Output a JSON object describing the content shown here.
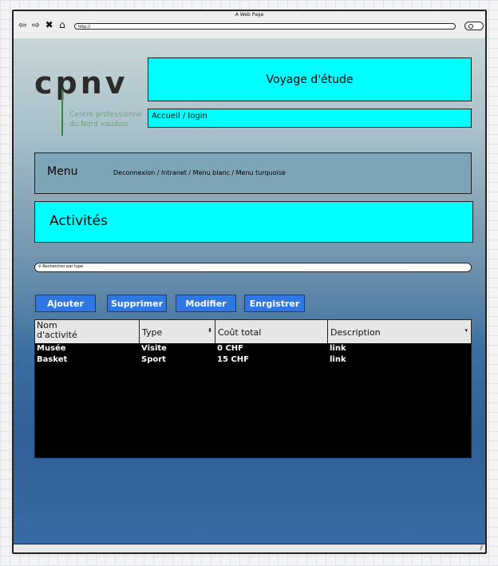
{
  "window": {
    "title": "A Web Page",
    "url": "http://"
  },
  "logo": {
    "word": "cpnv",
    "sub1": "Centre professionne",
    "sub2": "du Nord vaudois",
    "color": "#2f8a3a"
  },
  "header": {
    "title": "Voyage d'étude",
    "breadcrumb": "Accueil / login"
  },
  "menu": {
    "title": "Menu",
    "links": "Deconnexion / Intranet / Menu blanc / Menu turquoise"
  },
  "section": {
    "title": "Activités"
  },
  "search": {
    "placeholder": "Rechercher par type"
  },
  "buttons": {
    "add": "Ajouter",
    "delete": "Supprimer",
    "edit": "Modifier",
    "save": "Enrgistrer"
  },
  "table": {
    "headers": [
      {
        "line1": "Nom",
        "line2": "d'activité"
      },
      {
        "label": "Type"
      },
      {
        "label": "Coût total"
      },
      {
        "label": "Description"
      }
    ],
    "rows": [
      {
        "name": "Musée",
        "type": "Visite",
        "cost": "0 CHF",
        "description": "link"
      },
      {
        "name": "Basket",
        "type": "Sport",
        "cost": "15 CHF",
        "description": "link"
      }
    ]
  },
  "colors": {
    "accent_cyan": "#00ffff",
    "button_blue": "#2f78e1",
    "menu_gray": "#7ea5b5"
  }
}
